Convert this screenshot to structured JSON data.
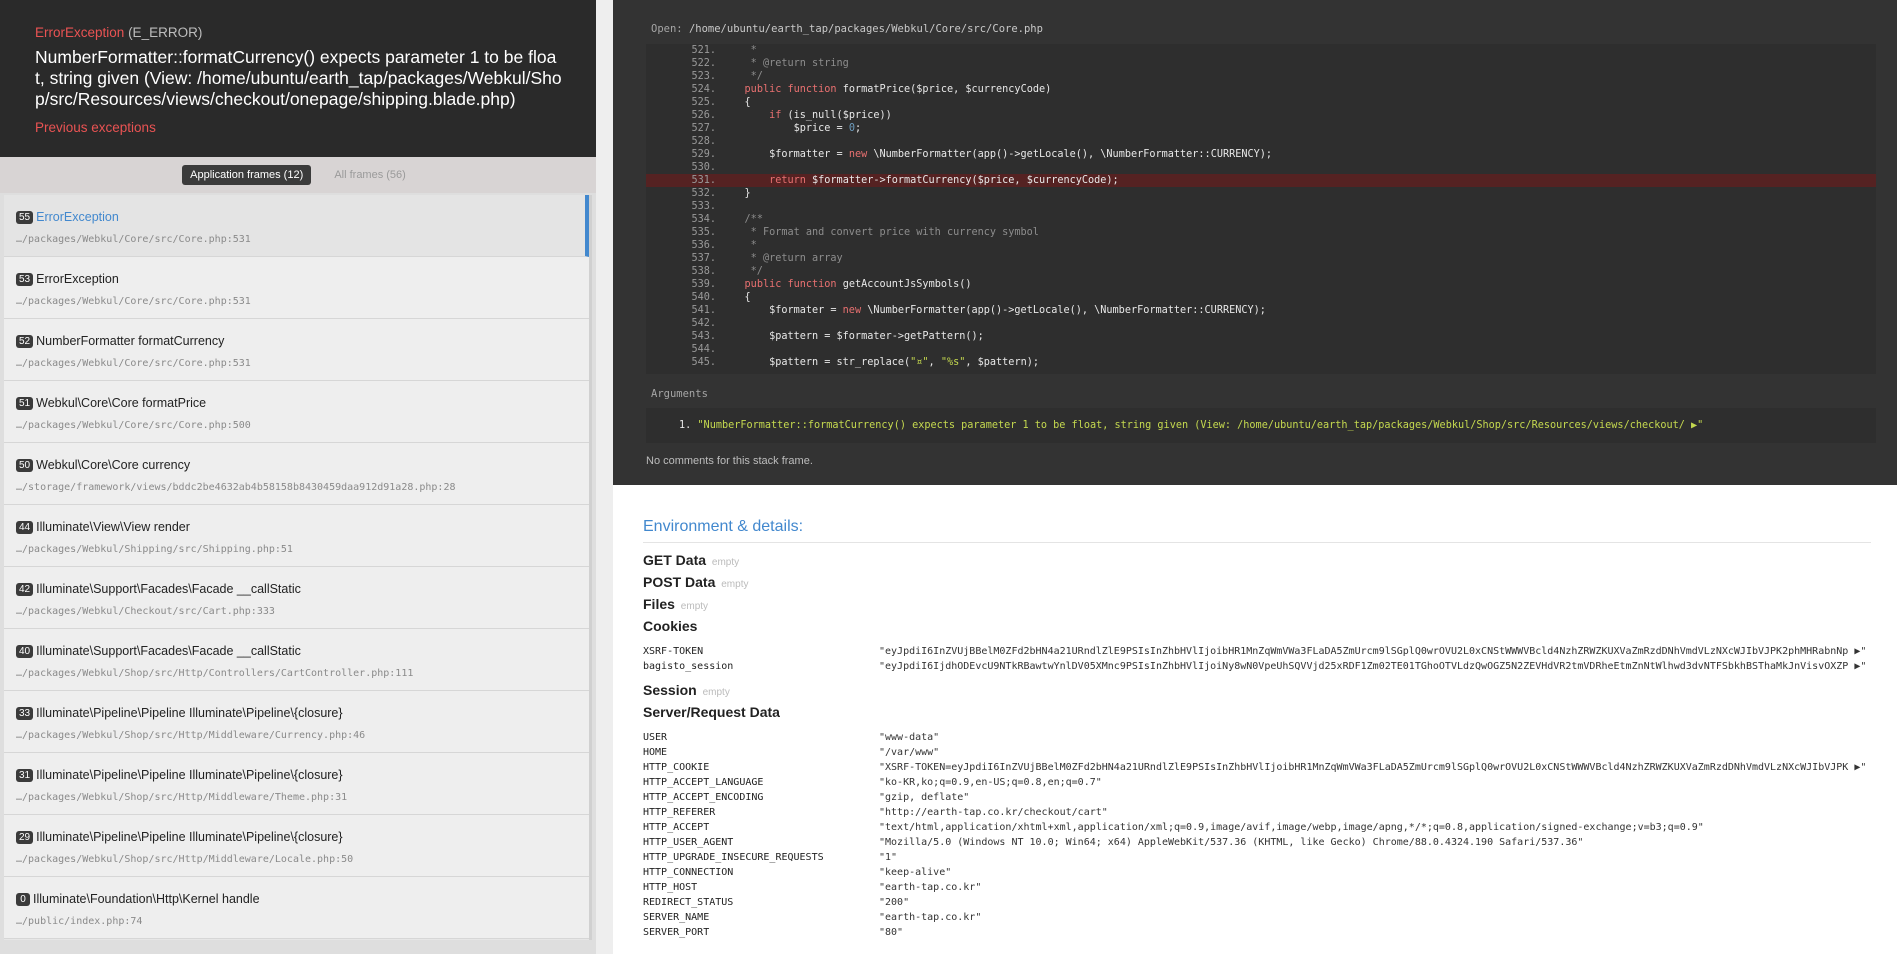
{
  "header": {
    "exception_class": "ErrorException",
    "exception_code": "(E_ERROR)",
    "message": "NumberFormatter::formatCurrency() expects parameter 1 to be float, string given (View: /home/ubuntu/earth_tap/packages/Webkul/Shop/src/Resources/views/checkout/onepage/shipping.blade.php)",
    "previous_exceptions": "Previous exceptions"
  },
  "frame_filter": {
    "application_frames": "Application frames (12)",
    "all_frames": "All frames (56)"
  },
  "frames": [
    {
      "index": "55",
      "name": "ErrorException",
      "file": "…/packages/Webkul/Core/src/Core.php:531"
    },
    {
      "index": "53",
      "name": "ErrorException",
      "file": "…/packages/Webkul/Core/src/Core.php:531"
    },
    {
      "index": "52",
      "name": "NumberFormatter formatCurrency",
      "file": "…/packages/Webkul/Core/src/Core.php:531"
    },
    {
      "index": "51",
      "name": "Webkul\\Core\\Core formatPrice",
      "file": "…/packages/Webkul/Core/src/Core.php:500"
    },
    {
      "index": "50",
      "name": "Webkul\\Core\\Core currency",
      "file": "…/storage/framework/views/bddc2be4632ab4b58158b8430459daa912d91a28.php:28"
    },
    {
      "index": "44",
      "name": "Illuminate\\View\\View render",
      "file": "…/packages/Webkul/Shipping/src/Shipping.php:51"
    },
    {
      "index": "42",
      "name": "Illuminate\\Support\\Facades\\Facade __callStatic",
      "file": "…/packages/Webkul/Checkout/src/Cart.php:333"
    },
    {
      "index": "40",
      "name": "Illuminate\\Support\\Facades\\Facade __callStatic",
      "file": "…/packages/Webkul/Shop/src/Http/Controllers/CartController.php:111"
    },
    {
      "index": "33",
      "name": "Illuminate\\Pipeline\\Pipeline Illuminate\\Pipeline\\{closure}",
      "file": "…/packages/Webkul/Shop/src/Http/Middleware/Currency.php:46"
    },
    {
      "index": "31",
      "name": "Illuminate\\Pipeline\\Pipeline Illuminate\\Pipeline\\{closure}",
      "file": "…/packages/Webkul/Shop/src/Http/Middleware/Theme.php:31"
    },
    {
      "index": "29",
      "name": "Illuminate\\Pipeline\\Pipeline Illuminate\\Pipeline\\{closure}",
      "file": "…/packages/Webkul/Shop/src/Http/Middleware/Locale.php:50"
    },
    {
      "index": "0",
      "name": "Illuminate\\Foundation\\Http\\Kernel handle",
      "file": "…/public/index.php:74"
    }
  ],
  "code": {
    "open_label": "Open:",
    "open_path": "/home/ubuntu/earth_tap/packages/Webkul/Core/src/Core.php",
    "highlight_line": "531",
    "lines": [
      {
        "n": "521.",
        "html": "     <span class=\"cm\">*</span>"
      },
      {
        "n": "522.",
        "html": "     <span class=\"cm\">* @return string</span>"
      },
      {
        "n": "523.",
        "html": "     <span class=\"cm\">*/</span>"
      },
      {
        "n": "524.",
        "html": "    <span class=\"kw\">public function</span> formatPrice($price, $currencyCode)"
      },
      {
        "n": "525.",
        "html": "    {"
      },
      {
        "n": "526.",
        "html": "        <span class=\"kw\">if</span> (is_null($price))"
      },
      {
        "n": "527.",
        "html": "            $price = <span class=\"nm\">0</span>;"
      },
      {
        "n": "528.",
        "html": ""
      },
      {
        "n": "529.",
        "html": "        $formatter = <span class=\"kw\">new</span> \\NumberFormatter(app()->getLocale(), \\NumberFormatter::CURRENCY);"
      },
      {
        "n": "530.",
        "html": ""
      },
      {
        "n": "531.",
        "html": "        <span class=\"kw\">return</span> $formatter->formatCurrency($price, $currencyCode);"
      },
      {
        "n": "532.",
        "html": "    }"
      },
      {
        "n": "533.",
        "html": ""
      },
      {
        "n": "534.",
        "html": "    <span class=\"cm\">/**</span>"
      },
      {
        "n": "535.",
        "html": "     <span class=\"cm\">* Format and convert price with currency symbol</span>"
      },
      {
        "n": "536.",
        "html": "     <span class=\"cm\">*</span>"
      },
      {
        "n": "537.",
        "html": "     <span class=\"cm\">* @return array</span>"
      },
      {
        "n": "538.",
        "html": "     <span class=\"cm\">*/</span>"
      },
      {
        "n": "539.",
        "html": "    <span class=\"kw\">public function</span> getAccountJsSymbols()"
      },
      {
        "n": "540.",
        "html": "    {"
      },
      {
        "n": "541.",
        "html": "        $formater = <span class=\"kw\">new</span> \\NumberFormatter(app()->getLocale(), \\NumberFormatter::CURRENCY);"
      },
      {
        "n": "542.",
        "html": ""
      },
      {
        "n": "543.",
        "html": "        $pattern = $formater->getPattern();"
      },
      {
        "n": "544.",
        "html": ""
      },
      {
        "n": "545.",
        "html": "        $pattern = str_replace(<span class=\"st\">\"¤\"</span>, <span class=\"st\">\"%s\"</span>, $pattern);"
      }
    ]
  },
  "arguments": {
    "label": "Arguments",
    "items": [
      {
        "n": "1.",
        "value": "\"NumberFormatter::formatCurrency() expects parameter 1 to be float, string given (View: /home/ubuntu/earth_tap/packages/Webkul/Shop/src/Resources/views/checkout/ ▶\""
      }
    ]
  },
  "no_comments": "No comments for this stack frame.",
  "environment": {
    "title": "Environment & details:",
    "empty_label": "empty",
    "get_data": "GET Data",
    "post_data": "POST Data",
    "files": "Files",
    "cookies_title": "Cookies",
    "cookies": [
      {
        "k": "XSRF-TOKEN",
        "v": "\"eyJpdiI6InZVUjBBelM0ZFd2bHN4a21URndlZlE9PSIsInZhbHVlIjoibHR1MnZqWmVWa3FLaDA5ZmUrcm9lSGplQ0wrOVU2L0xCNStWWWVBcld4NzhZRWZKUXVaZmRzdDNhVmdVLzNXcWJIbVJPK2phMHRabnNp ▶\""
      },
      {
        "k": "bagisto_session",
        "v": "\"eyJpdiI6IjdhODEvcU9NTkRBawtwYnlDV05XMnc9PSIsInZhbHVlIjoiNy8wN0VpeUhSQVVjd25xRDF1Zm02TE01TGhoOTVLdzQwOGZ5N2ZEVHdVR2tmVDRheEtmZnNtWlhwd3dvNTFSbkhBSThaMkJnVisvOXZP ▶\""
      }
    ],
    "session": "Session",
    "server_title": "Server/Request Data",
    "server": [
      {
        "k": "USER",
        "v": "\"www-data\""
      },
      {
        "k": "HOME",
        "v": "\"/var/www\""
      },
      {
        "k": "HTTP_COOKIE",
        "v": "\"XSRF-TOKEN=eyJpdiI6InZVUjBBelM0ZFd2bHN4a21URndlZlE9PSIsInZhbHVlIjoibHR1MnZqWmVWa3FLaDA5ZmUrcm9lSGplQ0wrOVU2L0xCNStWWWVBcld4NzhZRWZKUXVaZmRzdDNhVmdVLzNXcWJIbVJPK ▶\""
      },
      {
        "k": "HTTP_ACCEPT_LANGUAGE",
        "v": "\"ko-KR,ko;q=0.9,en-US;q=0.8,en;q=0.7\""
      },
      {
        "k": "HTTP_ACCEPT_ENCODING",
        "v": "\"gzip, deflate\""
      },
      {
        "k": "HTTP_REFERER",
        "v": "\"http://earth-tap.co.kr/checkout/cart\""
      },
      {
        "k": "HTTP_ACCEPT",
        "v": "\"text/html,application/xhtml+xml,application/xml;q=0.9,image/avif,image/webp,image/apng,*/*;q=0.8,application/signed-exchange;v=b3;q=0.9\""
      },
      {
        "k": "HTTP_USER_AGENT",
        "v": "\"Mozilla/5.0 (Windows NT 10.0; Win64; x64) AppleWebKit/537.36 (KHTML, like Gecko) Chrome/88.0.4324.190 Safari/537.36\""
      },
      {
        "k": "HTTP_UPGRADE_INSECURE_REQUESTS",
        "v": "\"1\""
      },
      {
        "k": "HTTP_CONNECTION",
        "v": "\"keep-alive\""
      },
      {
        "k": "HTTP_HOST",
        "v": "\"earth-tap.co.kr\""
      },
      {
        "k": "REDIRECT_STATUS",
        "v": "\"200\""
      },
      {
        "k": "SERVER_NAME",
        "v": "\"earth-tap.co.kr\""
      },
      {
        "k": "SERVER_PORT",
        "v": "\"80\""
      }
    ]
  }
}
